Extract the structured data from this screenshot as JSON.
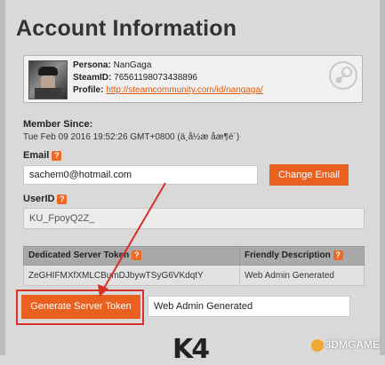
{
  "page": {
    "title": "Account Information"
  },
  "profile": {
    "persona_label": "Persona:",
    "persona_value": "NanGaga",
    "steamid_label": "SteamID:",
    "steamid_value": "76561198073438896",
    "profile_label": "Profile:",
    "profile_url": "http://steamcommunity.com/id/nangaga/"
  },
  "member_since": {
    "label": "Member Since:",
    "value": "Tue Feb 09 2016 19:52:26 GMT+0800 (ä¸­å½æ åæ¶é´)"
  },
  "email": {
    "label": "Email",
    "value": "sachem0@hotmail.com",
    "change_button": "Change Email"
  },
  "userid": {
    "label": "UserID",
    "value": "KU_FpoyQ2Z_"
  },
  "token_table": {
    "headers": [
      "Dedicated Server Token",
      "Friendly Description"
    ],
    "rows": [
      [
        "ZeGHIFMXfXMLCBumDJbywTSyG6VKdqtY",
        "Web Admin Generated"
      ]
    ]
  },
  "generate": {
    "button_label": "Generate Server Token",
    "description_value": "Web Admin Generated"
  },
  "bottom_glyph": "K4",
  "watermark": "3DMGAME",
  "colors": {
    "accent": "#e9601f",
    "highlight_red": "#d7302a",
    "link": "#e05a0c"
  },
  "icons": {
    "help": "question-mark-icon",
    "steam": "steam-logo-icon"
  }
}
